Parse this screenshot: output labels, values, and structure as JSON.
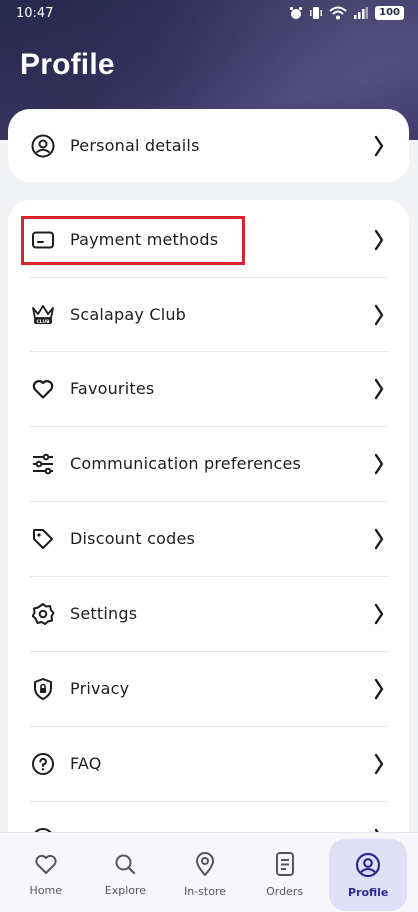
{
  "status_bar": {
    "time": "10:47",
    "battery": "100"
  },
  "header": {
    "title": "Profile"
  },
  "top_card": {
    "items": [
      {
        "label": "Personal details",
        "icon": "user-circle-icon"
      }
    ]
  },
  "menu": {
    "items": [
      {
        "label": "Payment methods",
        "icon": "card-icon"
      },
      {
        "label": "Scalapay Club",
        "icon": "crown-club-icon",
        "badge": "CLUB"
      },
      {
        "label": "Favourites",
        "icon": "heart-icon"
      },
      {
        "label": "Communication preferences",
        "icon": "sliders-icon"
      },
      {
        "label": "Discount codes",
        "icon": "tag-icon"
      },
      {
        "label": "Settings",
        "icon": "gear-icon"
      },
      {
        "label": "Privacy",
        "icon": "shield-lock-icon"
      },
      {
        "label": "FAQ",
        "icon": "question-circle-icon"
      }
    ]
  },
  "tabbar": {
    "items": [
      {
        "label": "Home",
        "icon": "heart-icon",
        "active": false
      },
      {
        "label": "Explore",
        "icon": "search-icon",
        "active": false
      },
      {
        "label": "In-store",
        "icon": "location-pin-icon",
        "active": false
      },
      {
        "label": "Orders",
        "icon": "document-icon",
        "active": false
      },
      {
        "label": "Profile",
        "icon": "user-circle-icon",
        "active": true
      }
    ]
  },
  "colors": {
    "header": "#3b3766",
    "accent": "#2f2a8c",
    "active_tab_bg": "#dfe0f7",
    "highlight": "#d8232a"
  }
}
